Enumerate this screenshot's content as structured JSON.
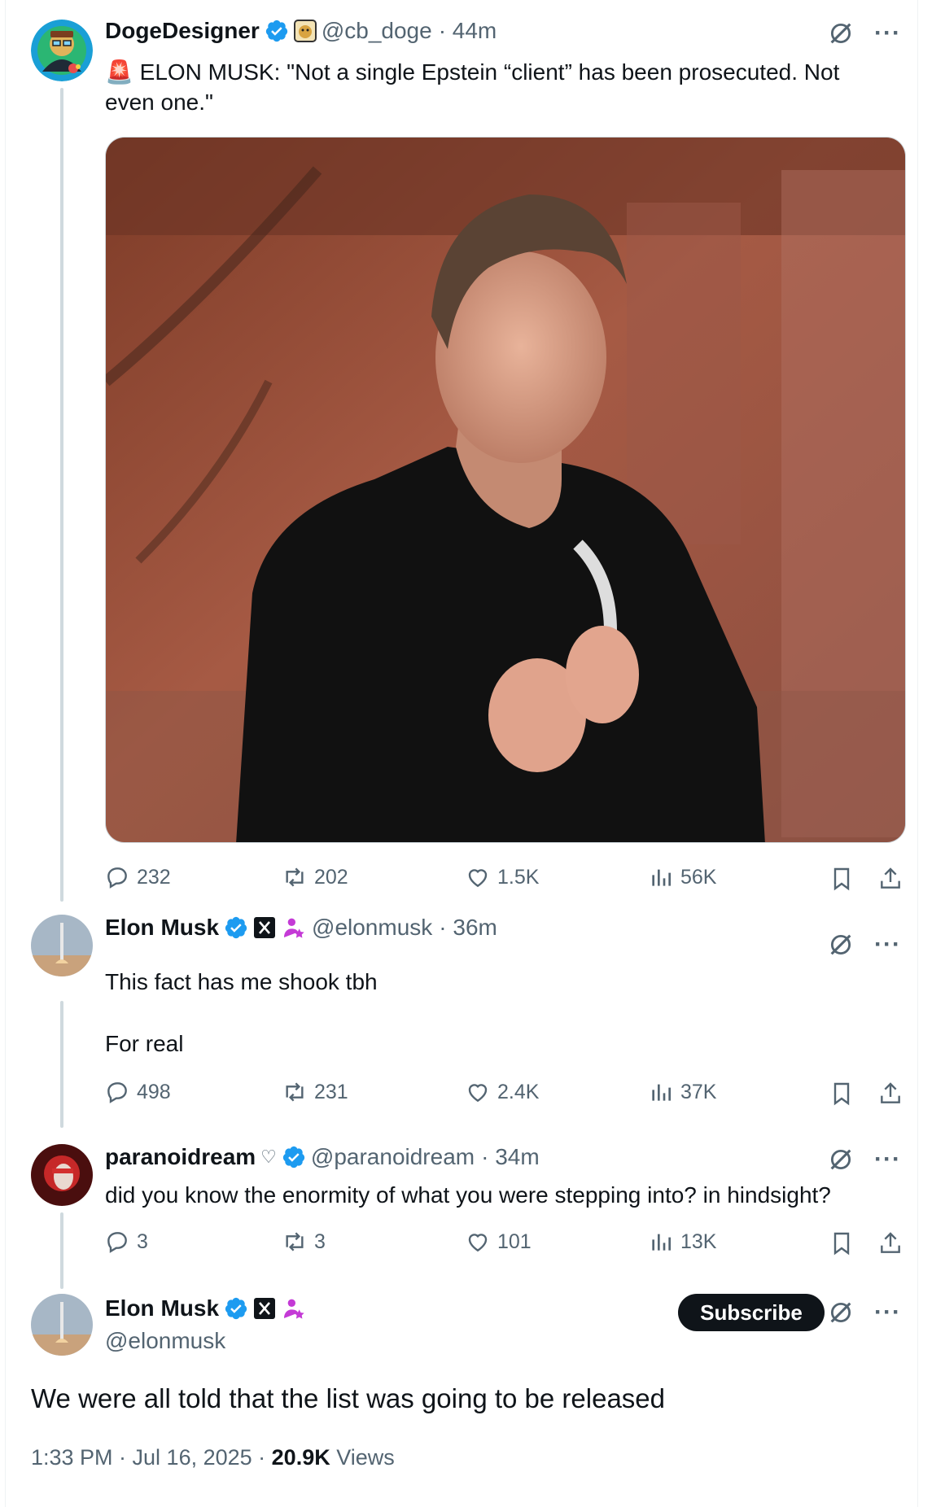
{
  "colors": {
    "verified": "#1d9bf0",
    "text": "#0f1419",
    "muted": "#536471",
    "line": "#cfd9de",
    "affiliate": "#c43ad6"
  },
  "tweets": [
    {
      "name": "DogeDesigner",
      "handle": "@cb_doge",
      "time": "· 44m",
      "emoji": "🚨",
      "text": "ELON MUSK: \"Not a single Epstein “client” has been prosecuted. Not even one.\"",
      "stats": {
        "replies": "232",
        "reposts": "202",
        "likes": "1.5K",
        "views": "56K"
      }
    },
    {
      "name": "Elon Musk",
      "handle": "@elonmusk",
      "time": "· 36m",
      "line1": "This fact has me shook tbh",
      "line2": "For real",
      "stats": {
        "replies": "498",
        "reposts": "231",
        "likes": "2.4K",
        "views": "37K"
      }
    },
    {
      "name": "paranoidream",
      "heart": "♡",
      "handle": "@paranoidream",
      "time": "· 34m",
      "text": "did you know the enormity of what you were stepping into? in hindsight?",
      "stats": {
        "replies": "3",
        "reposts": "3",
        "likes": "101",
        "views": "13K"
      }
    }
  ],
  "main": {
    "name": "Elon Musk",
    "handle": "@elonmusk",
    "subscribe": "Subscribe",
    "text": "We were all told that the list was going to be released",
    "time": "1:33 PM · Jul 16, 2025 · ",
    "views_count": "20.9K",
    "views_label": " Views"
  }
}
